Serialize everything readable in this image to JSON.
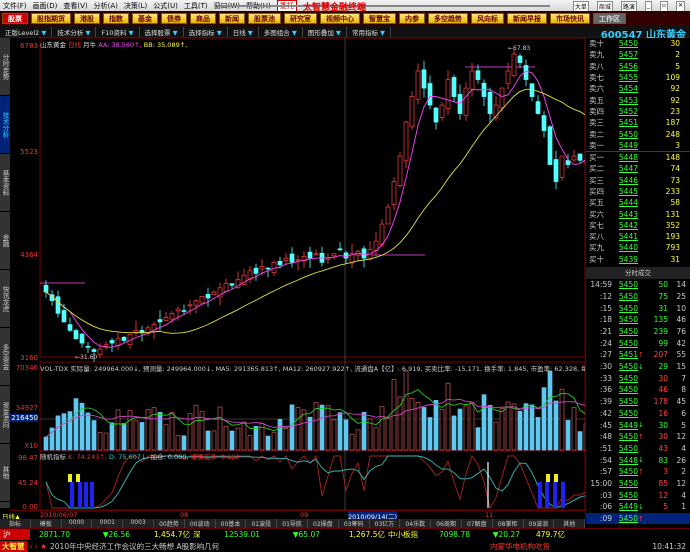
{
  "menu": [
    "文件(F)",
    "画面(D)",
    "查看(V)",
    "分析(A)",
    "决策(L)",
    "公式(U)",
    "工具(T)",
    "窗口(W)",
    "帮助(H)"
  ],
  "entrust": "委托",
  "app_title": "太智慧金融终端",
  "top_right": [
    "大单",
    "商城",
    "路演"
  ],
  "nav": [
    "股票",
    "股指期货",
    "港股",
    "指数",
    "基金",
    "债券",
    "商品",
    "新闻",
    "股票池",
    "研究室",
    "视频中心",
    "智慧宝",
    "内参",
    "多空趋势",
    "风向标",
    "新闻早报",
    "市场快讯",
    "工作区"
  ],
  "toolbar": {
    "items": [
      "正版Level2",
      "技术分析",
      "F10资料",
      "选择股票",
      "选择指标",
      "日线",
      "多图组合",
      "图形叠加",
      "常用指标"
    ],
    "stock": "600547 山东黄金"
  },
  "left_tabs": [
    "分时走势",
    "技术分析",
    "基本资料",
    "金融",
    "快讯龙虎",
    "多空资金",
    "资金流向",
    "其他"
  ],
  "price_axis": [
    "6783",
    "5523",
    "4364",
    "3160"
  ],
  "chart_header": {
    "name": "山东黄金",
    "period": "日线",
    "adj": "月牛",
    "aa": "AA: 38.560↑,",
    "bb": "BB: 35.089↑,"
  },
  "annotations": {
    "high": "←67.83",
    "low": "←31.60"
  },
  "vol_axis": [
    "70346",
    "34927",
    "216450",
    "X10"
  ],
  "vol_header": "VOL-TDX 实际量: 249964.000↓, 预测量: 249964.000↓, MA5: 291365.813↑, MA12: 260927.922↑, 流通盘A【亿】: 6.919, 买卖比率: -15.171, 换手率: 1.845, 市盈率: 62.328, 每股收益【元】",
  "ind_axis": [
    "98.47",
    "45.24",
    "0.00"
  ],
  "ind_header": {
    "name": "随机指标",
    "k": "K: 74.243↑,",
    "d": "D: 75.607↓,",
    "add": "加仓: 0.000,",
    "warn": "谨慎买多: 0.000"
  },
  "dates": {
    "period": "日线▲",
    "labels": [
      "2010/06/07",
      "08",
      "09",
      "2010/09/14(二)",
      "11"
    ]
  },
  "bottom_tabs": [
    "指标",
    "模板",
    "0000",
    "0001",
    "0003",
    "00趋势",
    "00波动",
    "00基本",
    "01波段",
    "01导航",
    "02操盘",
    "03筹码",
    "03亿万",
    "04乐数",
    "06周期",
    "07解盘",
    "08掌柜",
    "09波浪",
    "其他"
  ],
  "index_bar": {
    "sh_label": "沪",
    "sh": "2871.70",
    "sh_chg": "▼26.56",
    "sh_amt": "1,454.7亿",
    "sz_label": "深",
    "sz": "12539.01",
    "sz_chg": "▼65.07",
    "sz_amt": "1,267.5亿",
    "sme_label": "中小板指",
    "sme": "7098.78",
    "sme_chg": "▼20.27",
    "sme_amt": "479.7亿"
  },
  "news": {
    "logo": "大智慧",
    "text": "2010年中央经济工作会议的三大畅想 A股影响几何",
    "right": "内蒙华电机构吃货",
    "time": "10:41:32"
  },
  "orderbook": {
    "sells": [
      [
        "卖十",
        "5450",
        "30"
      ],
      [
        "卖九",
        "5457",
        "2"
      ],
      [
        "卖八",
        "5456",
        "5"
      ],
      [
        "卖七",
        "5455",
        "109"
      ],
      [
        "卖六",
        "5454",
        "92"
      ],
      [
        "卖五",
        "5453",
        "92"
      ],
      [
        "卖四",
        "5452",
        "23"
      ],
      [
        "卖三",
        "5451",
        "187"
      ],
      [
        "卖二",
        "5450",
        "248"
      ],
      [
        "卖一",
        "5449",
        "3"
      ]
    ],
    "buys": [
      [
        "买一",
        "5448",
        "148"
      ],
      [
        "买二",
        "5447",
        "74"
      ],
      [
        "买三",
        "5446",
        "73"
      ],
      [
        "买四",
        "5445",
        "233"
      ],
      [
        "买五",
        "5444",
        "58"
      ],
      [
        "买六",
        "5443",
        "131"
      ],
      [
        "买七",
        "5442",
        "352"
      ],
      [
        "买八",
        "5441",
        "193"
      ],
      [
        "买九",
        "5440",
        "793"
      ],
      [
        "买十",
        "5439",
        "31"
      ]
    ]
  },
  "trades_title": "分时成交",
  "trades": [
    [
      "14:59",
      "5450",
      "",
      "50",
      "14",
      "g"
    ],
    [
      ":12",
      "5450",
      "",
      "75",
      "25",
      "g"
    ],
    [
      ":15",
      "5450",
      "",
      "31",
      "10",
      "g"
    ],
    [
      ":18",
      "5450",
      "",
      "135",
      "46",
      "g"
    ],
    [
      ":21",
      "5450",
      "",
      "239",
      "76",
      "g"
    ],
    [
      ":24",
      "5450",
      "",
      "99",
      "42",
      "g"
    ],
    [
      ":27",
      "5451",
      "↑",
      "207",
      "55",
      "r"
    ],
    [
      ":30",
      "5450",
      "↓",
      "29",
      "15",
      "g"
    ],
    [
      ":33",
      "5450",
      "",
      "30",
      "7",
      "r"
    ],
    [
      ":36",
      "5450",
      "",
      "46",
      "8",
      "r"
    ],
    [
      ":39",
      "5450",
      "",
      "178",
      "45",
      "r"
    ],
    [
      ":42",
      "5450",
      "",
      "16",
      "6",
      "r"
    ],
    [
      ":45",
      "5449",
      "↓",
      "30",
      "5",
      "g"
    ],
    [
      ":48",
      "5450",
      "↑",
      "30",
      "12",
      "r"
    ],
    [
      ":51",
      "5450",
      "",
      "43",
      "4",
      "r"
    ],
    [
      ":54",
      "5448",
      "↓",
      "83",
      "26",
      "g"
    ],
    [
      ":57",
      "5450",
      "↑",
      "3",
      "2",
      "r"
    ],
    [
      "15:00",
      "5450",
      "",
      "85",
      "12",
      "r"
    ],
    [
      ":03",
      "5450",
      "",
      "12",
      "4",
      "r"
    ],
    [
      ":06",
      "5449",
      "↓",
      "5",
      "1",
      "r"
    ],
    [
      ":09",
      "5450",
      "↑",
      "",
      "",
      ""
    ]
  ],
  "right_tabs": [
    "分笔",
    "TOP",
    "委托"
  ],
  "series": {
    "closes": [
      3900,
      3800,
      3650,
      3550,
      3450,
      3350,
      3300,
      3250,
      3200,
      3230,
      3280,
      3300,
      3350,
      3330,
      3400,
      3450,
      3420,
      3480,
      3520,
      3550,
      3600,
      3650,
      3700,
      3680,
      3750,
      3800,
      3850,
      3830,
      3900,
      3950,
      4000,
      3980,
      4050,
      4100,
      4150,
      4120,
      4200,
      4180,
      4250,
      4220,
      4300,
      4250,
      4280,
      4320,
      4300,
      4350,
      4250,
      4300,
      4350,
      4400,
      4300,
      4350,
      4380,
      4300,
      4400,
      4500,
      4700,
      4900,
      5200,
      5500,
      5900,
      6200,
      6500,
      6300,
      6100,
      5900,
      6100,
      6400,
      6200,
      6000,
      6300,
      6500,
      6400,
      6200,
      6000,
      6100,
      6300,
      6500,
      6700,
      6600,
      6400,
      6200,
      6000,
      5800,
      5400,
      5200,
      5500,
      5400,
      5500,
      5450,
      5450
    ],
    "price_range": [
      3160,
      6783
    ],
    "vol_max": 70346
  },
  "colors": {
    "up": "#ff4040",
    "down": "#54ffff",
    "ma5": "#ff40ff",
    "ma20": "#e0e040"
  }
}
